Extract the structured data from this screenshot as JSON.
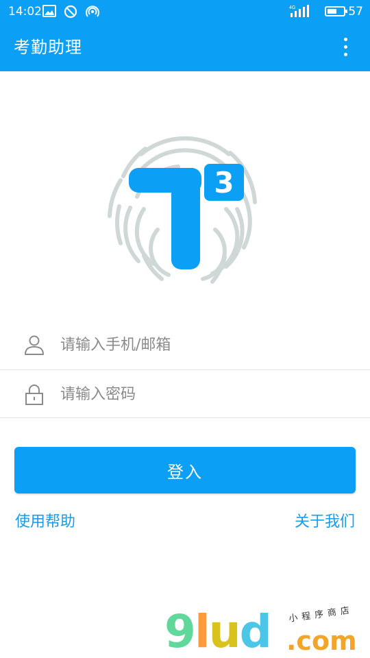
{
  "status_bar": {
    "time": "14:02",
    "network": "4G",
    "battery_text": "57",
    "battery_level": 0.57
  },
  "app_bar": {
    "title": "考勤助理"
  },
  "logo": {
    "superscript": "3",
    "accent": "#0ba0f5",
    "fingerprint_color": "#cfd8d6"
  },
  "login_form": {
    "username_placeholder": "请输入手机/邮箱",
    "password_placeholder": "请输入密码",
    "login_label": "登入"
  },
  "links": {
    "help": "使用帮助",
    "about": "关于我们"
  },
  "watermark": {
    "main_9": "9",
    "main_l": "l",
    "main_u": "u",
    "main_d": "d",
    "com": ".com",
    "small": "小程序商店"
  },
  "colors": {
    "primary": "#0ba0f5",
    "link": "#1a9be6",
    "placeholder": "#8a8a8a"
  }
}
